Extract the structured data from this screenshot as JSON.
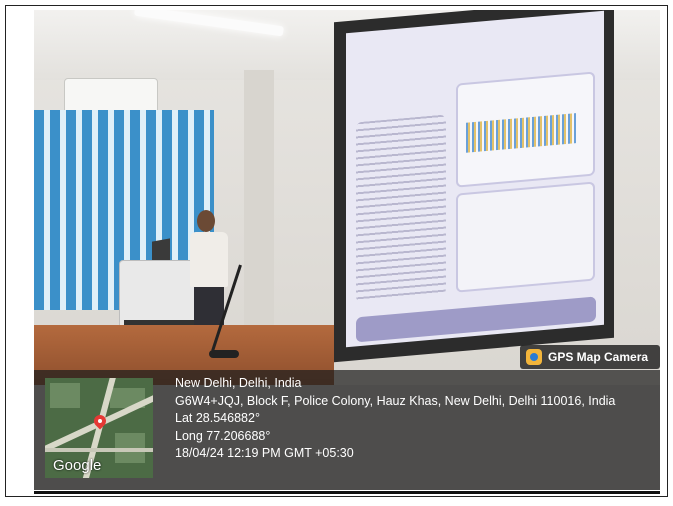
{
  "overlay": {
    "badge_label": "GPS Map Camera",
    "map_attribution": "Google",
    "location_line1": "New Delhi, Delhi, India",
    "location_line2": "G6W4+JQJ, Block F, Police Colony, Hauz Khas, New Delhi, Delhi 110016, India",
    "latitude": "Lat 28.546882°",
    "longitude": "Long 77.206688°",
    "timestamp": "18/04/24 12:19 PM GMT +05:30"
  },
  "icons": {
    "badge_icon": "camera-app-icon",
    "map_pin": "map-pin-icon"
  },
  "colors": {
    "overlay_bg": "#1e1e1e",
    "pin": "#e53935",
    "blinds": "#3b90c9",
    "table": "#b46a3e"
  }
}
